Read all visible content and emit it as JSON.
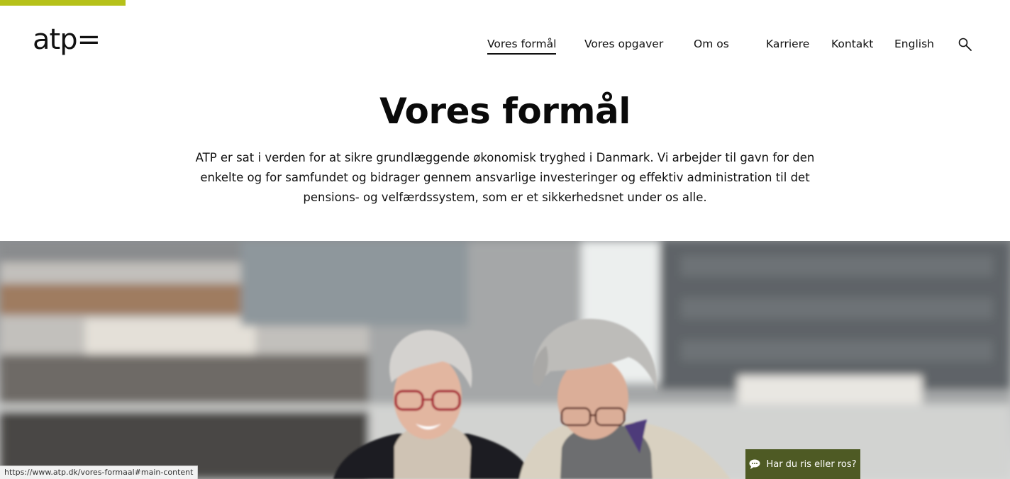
{
  "brand": {
    "logo_text": "atp=",
    "accent_color": "#b6c11a"
  },
  "nav": {
    "primary": [
      "Vores formål",
      "Vores opgaver",
      "Om os"
    ],
    "secondary": [
      "Karriere",
      "Kontakt",
      "English"
    ],
    "active": "Vores formål"
  },
  "page": {
    "title": "Vores formål",
    "intro": "ATP er sat i verden for at sikre grundlæggende økonomisk tryghed i Danmark. Vi arbejder til gavn for den enkelte og for samfundet og bidrager gennem ansvarlige investeringer og effektiv administration til det pensions- og velfærdssystem, som er et sikkerhedsnet under os alle."
  },
  "hero": {
    "alt": "Two smiling older women walking outdoors by the harbour"
  },
  "status_bar": {
    "url": "https://www.atp.dk/vores-formaal#main-content"
  },
  "feedback": {
    "label": "Har du ris eller ros?",
    "color": "#4e5a24"
  }
}
